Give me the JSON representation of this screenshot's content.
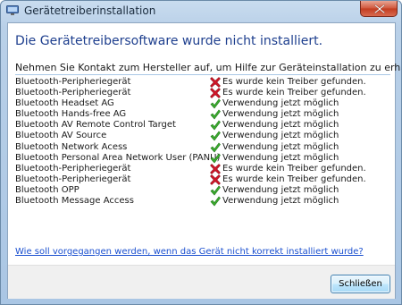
{
  "window": {
    "title": "Gerätetreiberinstallation",
    "icons": {
      "app": "device-installer-icon",
      "close": "close-icon"
    }
  },
  "content": {
    "heading": "Die Gerätetreibersoftware wurde nicht installiert.",
    "subheading": "Nehmen Sie Kontakt zum Hersteller auf, um Hilfe zur Geräteinstallation zu erhalten."
  },
  "devices": [
    {
      "name": "Bluetooth-Peripheriegerät",
      "status": "error",
      "status_text": "Es wurde kein Treiber gefunden."
    },
    {
      "name": "Bluetooth-Peripheriegerät",
      "status": "error",
      "status_text": "Es wurde kein Treiber gefunden."
    },
    {
      "name": "Bluetooth Headset AG",
      "status": "ok",
      "status_text": "Verwendung jetzt möglich"
    },
    {
      "name": "Bluetooth Hands-free AG",
      "status": "ok",
      "status_text": "Verwendung jetzt möglich"
    },
    {
      "name": "Bluetooth AV Remote Control Target",
      "status": "ok",
      "status_text": "Verwendung jetzt möglich"
    },
    {
      "name": "Bluetooth AV Source",
      "status": "ok",
      "status_text": "Verwendung jetzt möglich"
    },
    {
      "name": "Bluetooth Network Acess",
      "status": "ok",
      "status_text": "Verwendung jetzt möglich"
    },
    {
      "name": "Bluetooth Personal Area Network User (PANU)",
      "status": "ok",
      "status_text": "Verwendung jetzt möglich"
    },
    {
      "name": "Bluetooth-Peripheriegerät",
      "status": "error",
      "status_text": "Es wurde kein Treiber gefunden."
    },
    {
      "name": "Bluetooth-Peripheriegerät",
      "status": "error",
      "status_text": "Es wurde kein Treiber gefunden."
    },
    {
      "name": "Bluetooth OPP",
      "status": "ok",
      "status_text": "Verwendung jetzt möglich"
    },
    {
      "name": "Bluetooth Message Access",
      "status": "ok",
      "status_text": "Verwendung jetzt möglich"
    }
  ],
  "status_icons": {
    "ok": "green-checkmark-icon",
    "error": "red-x-icon"
  },
  "colors": {
    "heading": "#1e3f8e",
    "link": "#1a4fcf",
    "ok": "#3cab2f",
    "error": "#d5172a"
  },
  "help_link": "Wie soll vorgegangen werden, wenn das Gerät nicht korrekt installiert wurde?",
  "footer": {
    "close_label": "Schließen"
  }
}
